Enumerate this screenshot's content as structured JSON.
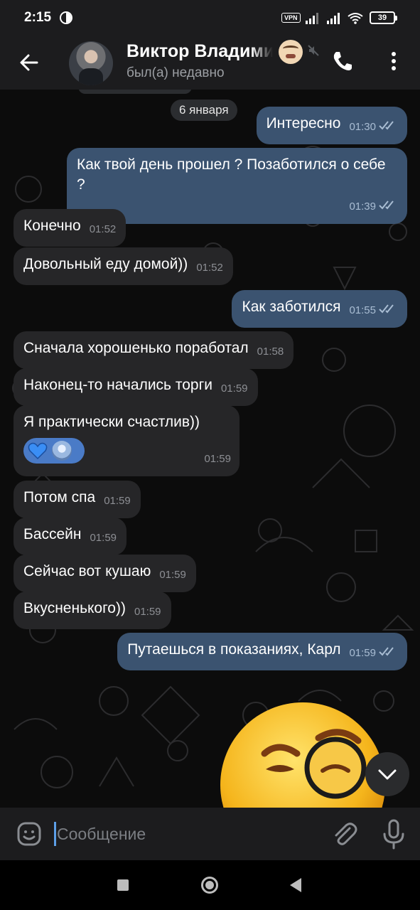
{
  "status_bar": {
    "time": "2:15",
    "vpn_label": "VPN",
    "battery": "39"
  },
  "header": {
    "contact_name": "Виктор Владими",
    "contact_status": "был(а) недавно"
  },
  "chat": {
    "date_separator": "6 января",
    "messages": [
      {
        "direction": "out",
        "text": "Интересно",
        "time": "01:30",
        "read": true
      },
      {
        "direction": "out",
        "text": "Как твой день прошел ? Позаботился о себе ?",
        "time": "01:39",
        "read": true
      },
      {
        "direction": "in",
        "text": "Конечно",
        "time": "01:52"
      },
      {
        "direction": "in",
        "text": "Довольный еду домой))",
        "time": "01:52"
      },
      {
        "direction": "out",
        "text": "Как заботился",
        "time": "01:55",
        "read": true
      },
      {
        "direction": "in",
        "text": "Сначала хорошенько поработал",
        "time": "01:58"
      },
      {
        "direction": "in",
        "text": "Наконец-то начались торги",
        "time": "01:59"
      },
      {
        "direction": "in",
        "text": "Я практически счастлив))",
        "time": "01:59",
        "reaction": "blue-heart"
      },
      {
        "direction": "in",
        "text": "Потом спа",
        "time": "01:59"
      },
      {
        "direction": "in",
        "text": "Бассейн",
        "time": "01:59"
      },
      {
        "direction": "in",
        "text": "Сейчас вот кушаю",
        "time": "01:59"
      },
      {
        "direction": "in",
        "text": "Вкусненького))",
        "time": "01:59"
      },
      {
        "direction": "out",
        "text": "Путаешься в показаниях, Карл",
        "time": "01:59",
        "read": true
      }
    ]
  },
  "composer": {
    "placeholder": "Сообщение"
  },
  "colors": {
    "incoming_bubble": "#262628",
    "outgoing_bubble": "#3b5370",
    "accent": "#5c9ee6",
    "reaction_pill": "#4a7bc7"
  },
  "icons": {
    "back": "back-arrow-icon",
    "call": "phone-icon",
    "menu": "kebab-menu-icon",
    "mute": "muted-icon",
    "emoji": "emoji-icon",
    "attach": "paperclip-icon",
    "mic": "microphone-icon",
    "scroll": "chevron-down-icon",
    "read": "double-check-icon"
  }
}
